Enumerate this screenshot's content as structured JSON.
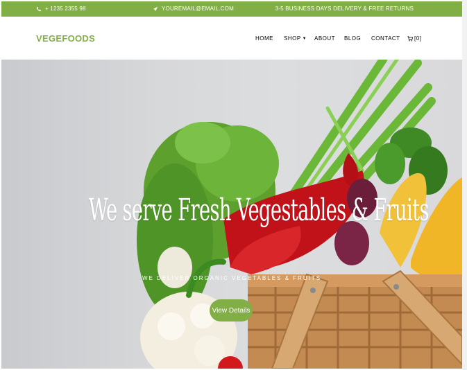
{
  "topbar": {
    "phone": "+ 1235 2355 98",
    "email": "YOUREMAIL@EMAIL.COM",
    "delivery": "3-5 BUSINESS DAYS DELIVERY & FREE RETURNS",
    "phone_icon": "phone-icon",
    "email_icon": "paper-plane-icon",
    "background": "#82ae46"
  },
  "brand": {
    "name": "VEGEFOODS",
    "color": "#82ae46"
  },
  "nav": {
    "home": "HOME",
    "shop": "SHOP",
    "about": "ABOUT",
    "blog": "BLOG",
    "contact": "CONTACT",
    "cart_count": "[0]",
    "cart_icon": "cart-icon"
  },
  "hero": {
    "title": "We serve Fresh Vegestables & Fruits",
    "subtitle": "WE DELIVER ORGANIC VEGETABLES & FRUITS",
    "cta": "View Details"
  }
}
